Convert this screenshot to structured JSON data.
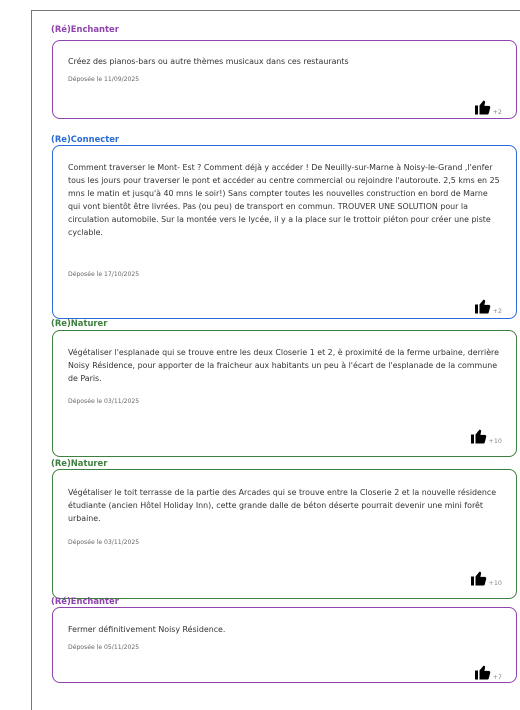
{
  "colors": {
    "rechanter": "#8e44ad",
    "reconnecter": "#2c6bd6",
    "renaturer": "#3f7f3f"
  },
  "proposals": [
    {
      "category": "(Ré)Enchanter",
      "color": "#8e44ad",
      "text": "Créez des pianos-bars ou autre thèmes musicaux dans ces restaurants",
      "date": "Déposée le 11/09/2025",
      "likes": "+2",
      "icon": "thumbs-up-icon"
    },
    {
      "category": "(Re)Connecter",
      "color": "#2c6bd6",
      "text": "Comment traverser le Mont- Est ? Comment déjà y accéder ! De Neuilly-sur-Marne à Noisy-le-Grand ,l'enfer tous les jours pour traverser le pont et accéder au centre commercial ou rejoindre l'autoroute. 2,5 kms en 25 mns le matin et jusqu'à 40 mns le soir!) Sans compter toutes les nouvelles construction en bord de Marne qui vont bientôt être livrées. Pas (ou peu) de transport en commun. TROUVER UNE SOLUTION pour la circulation automobile. Sur la montée vers le lycée, il y a la place sur le trottoir piéton pour créer une piste cyclable.",
      "date": "Déposée le 17/10/2025",
      "likes": "+2",
      "icon": "thumbs-up-icon"
    },
    {
      "category": "(Re)Naturer",
      "color": "#3f7f3f",
      "text": "Végétaliser l'esplanade qui se trouve entre les deux Closerie 1 et 2, è proximité de la ferme urbaine, derrière Noisy Résidence, pour apporter de la fraicheur aux habitants un peu à l'écart de l'esplanade de la commune de Paris.",
      "date": "Déposée le 03/11/2025",
      "likes": "+10",
      "icon": "thumbs-up-icon"
    },
    {
      "category": "(Re)Naturer",
      "color": "#3f7f3f",
      "text": "Végétaliser le toit terrasse de la partie des Arcades qui se trouve entre la Closerie 2 et la nouvelle résidence étudiante (ancien Hôtel Holiday Inn), cette grande dalle de béton déserte pourrait devenir une mini forêt urbaine.",
      "date": "Déposée le 03/11/2025",
      "likes": "+10",
      "icon": "thumbs-up-icon"
    },
    {
      "category": "(Ré)Enchanter",
      "color": "#8e44ad",
      "text": "Fermer définitivement Noisy Résidence.",
      "date": "Déposée le 05/11/2025",
      "likes": "+7",
      "icon": "thumbs-up-icon"
    }
  ]
}
